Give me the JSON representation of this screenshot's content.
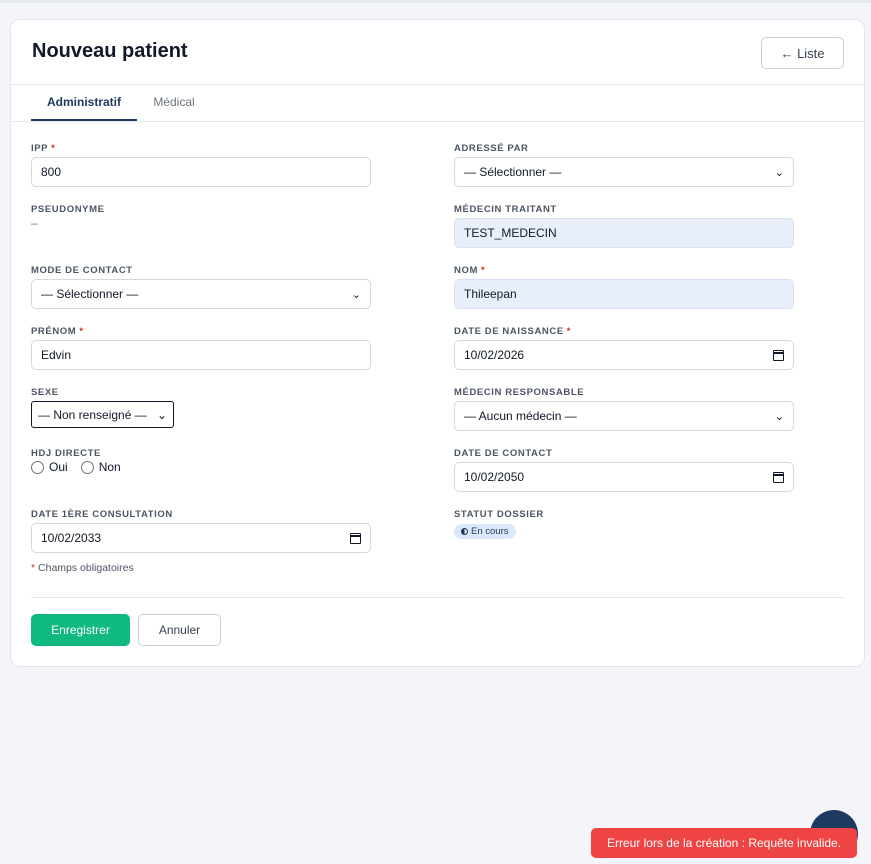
{
  "header": {
    "title": "Nouveau patient",
    "back_label": "← Liste"
  },
  "tabs": [
    {
      "label": "Administratif",
      "active": true
    },
    {
      "label": "Médical",
      "active": false
    }
  ],
  "form": {
    "ipp": {
      "label": "IPP",
      "value": "800",
      "required": "*"
    },
    "adresse_par": {
      "label": "Adressé par",
      "value": "— Sélectionner —"
    },
    "pseudonyme": {
      "label": "Pseudonyme",
      "value": "–"
    },
    "medecin_traitant": {
      "label": "Médecin traitant",
      "value": "TEST_MEDECIN"
    },
    "mode_contact": {
      "label": "Mode de contact",
      "value": "— Sélectionner —"
    },
    "nom": {
      "label": "Nom",
      "value": "Thileepan",
      "required": "*"
    },
    "prenom": {
      "label": "Prénom",
      "value": "Edvin",
      "required": "*"
    },
    "date_naissance": {
      "label": "Date de naissance",
      "value": "10/02/2026",
      "required": "*"
    },
    "sexe": {
      "label": "Sexe",
      "value": "— Non renseigné —"
    },
    "medecin_responsable": {
      "label": "Médecin responsable",
      "value": "— Aucun médecin —"
    },
    "hdj_directe": {
      "label": "HDJ directe",
      "options": [
        "Oui",
        "Non"
      ]
    },
    "date_contact": {
      "label": "Date de contact",
      "value": "10/02/2050"
    },
    "date_consultation": {
      "label": "Date 1ère consultation",
      "value": "10/02/2033"
    },
    "statut_dossier": {
      "label": "Statut dossier",
      "value": "En cours"
    }
  },
  "required_note": {
    "star": "*",
    "text": "Champs obligatoires"
  },
  "actions": {
    "save_label": "Enregistrer",
    "cancel_label": "Annuler"
  },
  "toast": {
    "message": "Erreur lors de la création : Requête invalide."
  },
  "colors": {
    "primary": "#1e3a5f",
    "success": "#10b981",
    "error": "#ef4444",
    "highlight_field": "#e8effb"
  }
}
